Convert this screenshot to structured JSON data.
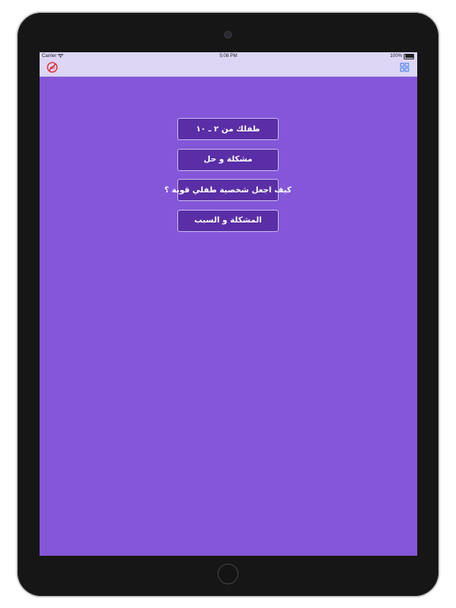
{
  "status_bar": {
    "carrier": "Carrier",
    "time": "5:08 PM",
    "battery": "100%",
    "battery_level": 1.0
  },
  "nav_bar": {
    "left_icon": "no-ads-icon",
    "right_icon": "grid-icon",
    "left_icon_color": "#e0242b",
    "right_icon_color": "#3a7bf0"
  },
  "colors": {
    "background": "#8456d8",
    "button": "#5a2ea6",
    "button_border": "#c9b8ef",
    "nav_bar": "#ddd6f5"
  },
  "menu": {
    "items": [
      {
        "label": "طفلك من ٢ ـ ١٠"
      },
      {
        "label": "مشكلة و حل"
      },
      {
        "label": "كيف اجعل شخصية طفلي قوية ؟"
      },
      {
        "label": "المشكلة و السبب"
      }
    ]
  }
}
